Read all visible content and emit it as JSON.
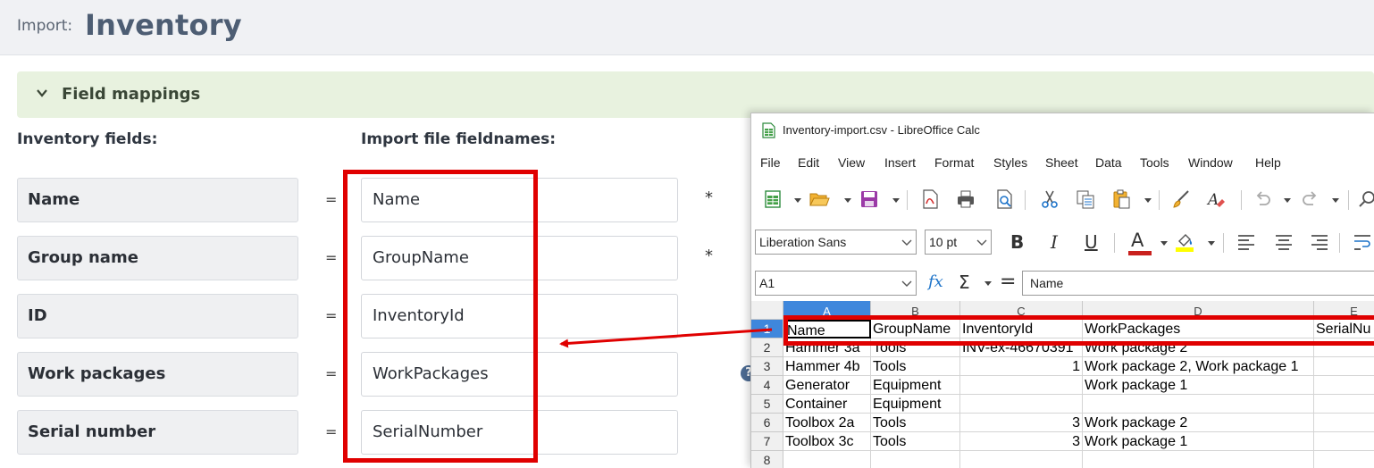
{
  "header": {
    "prefix": "Import:",
    "title": "Inventory"
  },
  "section": {
    "title": "Field mappings"
  },
  "columns": {
    "inventory_fields": "Inventory fields:",
    "import_fieldnames": "Import file fieldnames:"
  },
  "mappings": [
    {
      "label": "Name",
      "value": "Name",
      "required": "*"
    },
    {
      "label": "Group name",
      "value": "GroupName",
      "required": "*"
    },
    {
      "label": "ID",
      "value": "InventoryId",
      "required": ""
    },
    {
      "label": "Work packages",
      "value": "WorkPackages",
      "required": ""
    },
    {
      "label": "Serial number",
      "value": "SerialNumber",
      "required": ""
    }
  ],
  "equals_sign": "=",
  "help_icon": {
    "glyph": "?"
  },
  "calc": {
    "title": "Inventory-import.csv - LibreOffice Calc",
    "menu": [
      "File",
      "Edit",
      "View",
      "Insert",
      "Format",
      "Styles",
      "Sheet",
      "Data",
      "Tools",
      "Window",
      "Help"
    ],
    "font_name": "Liberation Sans",
    "font_size": "10 pt",
    "name_box": "A1",
    "formula": "Name",
    "format_buttons": {
      "bold": "B",
      "italic": "I",
      "underline": "U",
      "font_color": "A"
    },
    "formula_symbols": {
      "fx": "fx",
      "sigma": "Σ",
      "equals": "="
    },
    "col_headers": [
      "A",
      "B",
      "C",
      "D",
      "E"
    ],
    "row_headers": [
      "1",
      "2",
      "3",
      "4",
      "5",
      "6",
      "7",
      "8"
    ],
    "rows": [
      [
        "Name",
        "GroupName",
        "InventoryId",
        "WorkPackages",
        "SerialNu"
      ],
      [
        "Hammer 3a",
        "Tools",
        "INV-ex-46670391",
        "Work package 2",
        ""
      ],
      [
        "Hammer 4b",
        "Tools",
        "1",
        "Work package 2, Work package 1",
        ""
      ],
      [
        "Generator",
        "Equipment",
        "",
        "Work package 1",
        ""
      ],
      [
        "Container",
        "Equipment",
        "",
        "",
        ""
      ],
      [
        "Toolbox 2a",
        "Tools",
        "3",
        "Work package 2",
        ""
      ],
      [
        "Toolbox 3c",
        "Tools",
        "3",
        "Work package 1",
        ""
      ],
      [
        "",
        "",
        "",
        "",
        ""
      ]
    ]
  },
  "colors": {
    "highlight": "#e00000",
    "accent_blue": "#3f87dc",
    "section_bg": "#e8f2df"
  }
}
